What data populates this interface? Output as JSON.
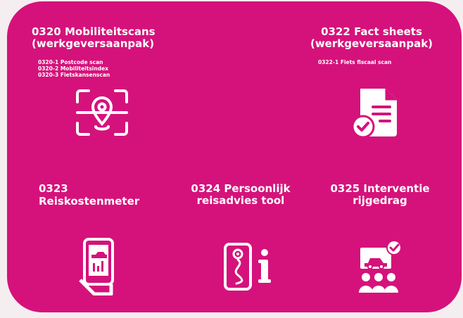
{
  "cards": [
    {
      "title_line1": "0320 Mobiliteitscans",
      "title_line2": "(werkgeversaanpak)",
      "items": [
        "0320-1 Postcode scan",
        "0320-2 Mobiliteitsindex",
        "0320-3 Fietskansenscan"
      ],
      "icon": "location-scan-icon"
    },
    {
      "title_line1": "0322 Fact sheets",
      "title_line2": "(werkgeversaanpak)",
      "items": [
        "0322-1 Fiets fiscaal scan"
      ],
      "icon": "document-check-icon"
    },
    {
      "title_line1": "0323 Reiskostenmeter",
      "title_line2": "",
      "icon": "phone-chart-icon"
    },
    {
      "title_line1": "0324 Persoonlijk",
      "title_line2": "reisadvies tool",
      "icon": "phone-route-info-icon"
    },
    {
      "title_line1": "0325 Interventie",
      "title_line2": "rijgedrag",
      "icon": "car-screen-audience-icon"
    }
  ],
  "colors": {
    "background": "#f5eef0",
    "panel": "#d5127b",
    "foreground": "#ffffff"
  }
}
